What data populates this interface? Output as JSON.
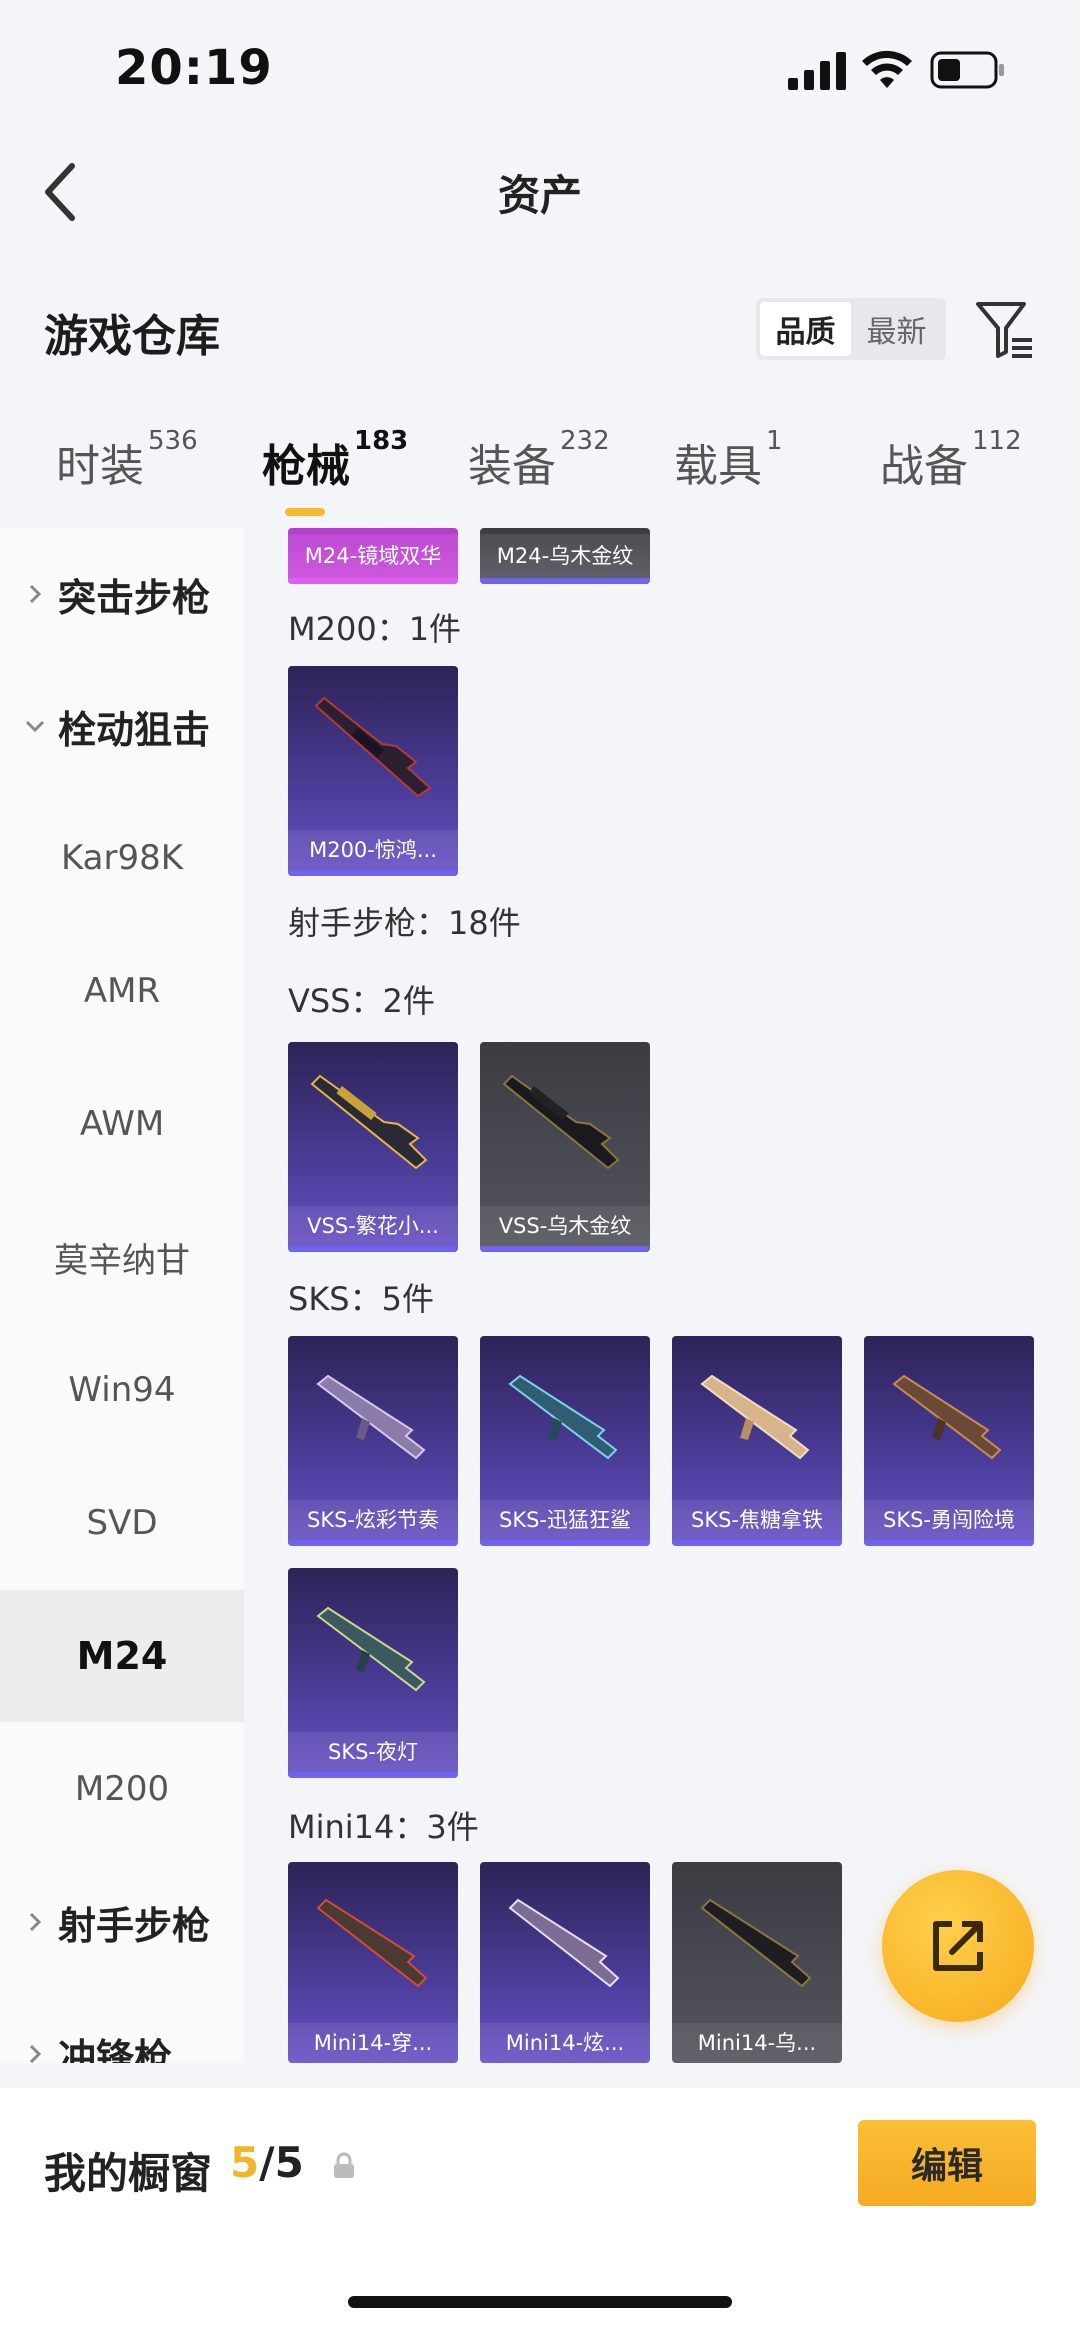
{
  "status": {
    "time": "20:19"
  },
  "nav": {
    "title": "资产"
  },
  "header": {
    "title": "游戏仓库",
    "sort_options": [
      "品质",
      "最新"
    ],
    "sort_active": "品质"
  },
  "tabs": [
    {
      "label": "时装",
      "count": "536"
    },
    {
      "label": "枪械",
      "count": "183",
      "active": true
    },
    {
      "label": "装备",
      "count": "232"
    },
    {
      "label": "载具",
      "count": "1"
    },
    {
      "label": "战备",
      "count": "112"
    }
  ],
  "sidebar": {
    "items": [
      {
        "label": "突击步枪",
        "type": "group",
        "expanded": false
      },
      {
        "label": "栓动狙击",
        "type": "group",
        "expanded": true
      },
      {
        "label": "Kar98K",
        "type": "item"
      },
      {
        "label": "AMR",
        "type": "item"
      },
      {
        "label": "AWM",
        "type": "item"
      },
      {
        "label": "莫辛纳甘",
        "type": "item"
      },
      {
        "label": "Win94",
        "type": "item"
      },
      {
        "label": "SVD",
        "type": "item"
      },
      {
        "label": "M24",
        "type": "item",
        "selected": true
      },
      {
        "label": "M200",
        "type": "item"
      },
      {
        "label": "射手步枪",
        "type": "group",
        "expanded": false
      },
      {
        "label": "冲锋枪",
        "type": "group",
        "expanded": false
      }
    ]
  },
  "content": {
    "top_cards": [
      "M24-镜域双华",
      "M24-乌木金纹"
    ],
    "sections": [
      {
        "label": "M200：1件",
        "cards": [
          "M200-惊鸿..."
        ]
      },
      {
        "label": "射手步枪：18件",
        "cards": []
      },
      {
        "label": "VSS：2件",
        "cards": [
          "VSS-繁花小...",
          "VSS-乌木金纹"
        ]
      },
      {
        "label": "SKS：5件",
        "cards": [
          "SKS-炫彩节奏",
          "SKS-迅猛狂鲨",
          "SKS-焦糖拿铁",
          "SKS-勇闯险境",
          "SKS-夜灯"
        ]
      },
      {
        "label": "Mini14：3件",
        "cards": [
          "Mini14-穿...",
          "Mini14-炫...",
          "Mini14-乌..."
        ]
      }
    ]
  },
  "bottom": {
    "showcase_label": "我的橱窗",
    "showcase_current": "5",
    "showcase_total": "/5",
    "edit_label": "编辑"
  },
  "colors": {
    "accent": "#f6b92b",
    "card_purple": "#4c3d9a",
    "card_gray": "#55555e"
  }
}
